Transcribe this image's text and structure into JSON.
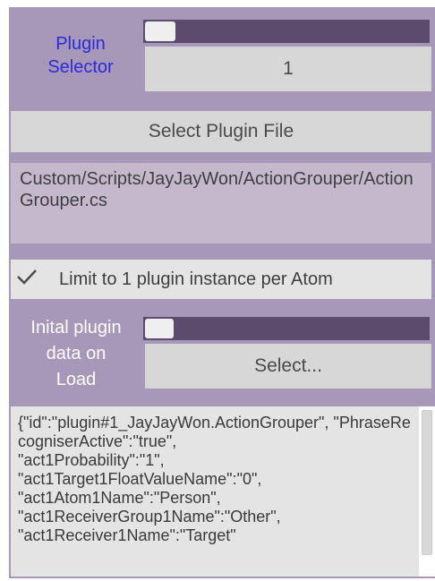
{
  "plugin_selector": {
    "label_line1": "Plugin",
    "label_line2": "Selector",
    "slider_value": 0.0,
    "selected_value": "1"
  },
  "select_file_button": "Select Plugin File",
  "plugin_path": "Custom/Scripts/JayJayWon/ActionGrouper/ActionGrouper.cs",
  "limit_checkbox": {
    "checked": true,
    "label": "Limit to 1 plugin instance per Atom"
  },
  "initial_data": {
    "label_line1": "Inital plugin",
    "label_line2": "data on",
    "label_line3": "Load",
    "slider_value": 0.0,
    "select_button": "Select..."
  },
  "json_text": "{\"id\":\"plugin#1_JayJayWon.ActionGrouper\", \"PhraseRecogniserActive\":\"true\",\n\"act1Probability\":\"1\",\n\"act1Target1FloatValueName\":\"0\",\n\"act1Atom1Name\":\"Person\",\n\"act1ReceiverGroup1Name\":\"Other\",\n\"act1Receiver1Name\":\"Target\""
}
